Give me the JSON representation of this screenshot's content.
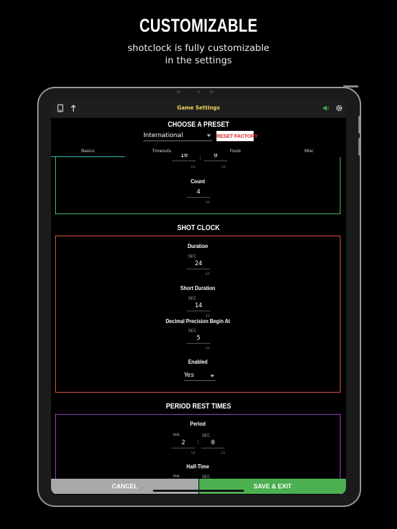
{
  "promo": {
    "headline": "CUSTOMIZABLE",
    "tagline_line1": "shotclock is fully customizable",
    "tagline_line2": "in the settings"
  },
  "app": {
    "title": "Game Settings",
    "preset_heading": "CHOOSE A PRESET",
    "preset_value": "International",
    "reset_label": "RESET FACTORY",
    "tabs": [
      "Basics",
      "Timeouts",
      "Fouls",
      "Misc"
    ],
    "active_tab": "Basics"
  },
  "partial_panel": {
    "min_value": "10",
    "sec_value": "0",
    "min_count": "2/3",
    "sec_count": "1/2",
    "count_label": "Count",
    "count_value": "4",
    "count_counter": "1/2"
  },
  "shot_clock": {
    "heading": "SHOT CLOCK",
    "duration_label": "Duration",
    "duration_unit": "SEC",
    "duration_value": "24",
    "duration_counter": "2/2",
    "short_label": "Short Duration",
    "short_unit": "SEC",
    "short_value": "14",
    "short_counter": "2/2",
    "decimal_label": "Decimal Precision Begin At",
    "decimal_unit": "SEC",
    "decimal_value": "5",
    "decimal_counter": "1/2",
    "enabled_label": "Enabled",
    "enabled_value": "Yes"
  },
  "period_rest": {
    "heading": "PERIOD REST TIMES",
    "period_label": "Period",
    "min_unit": "MIN",
    "sec_unit": "SEC",
    "period_min": "2",
    "period_sec": "0",
    "period_min_counter": "1/3",
    "period_sec_counter": "1/2",
    "halftime_label": "Half-Time",
    "half_min_unit": "MIN",
    "half_sec_unit": "SEC"
  },
  "footer": {
    "cancel_label": "CANCEL",
    "save_label": "SAVE & EXIT"
  },
  "colors": {
    "title_accent": "#f2d35a",
    "tab_accent": "#2ec4b6",
    "panel_green": "#3fbf5a",
    "panel_red": "#e2553f",
    "panel_purple": "#9b3fc8",
    "save_green": "#4caf50",
    "cancel_gray": "#a8a8a8",
    "reset_red": "#e02c2c"
  },
  "icons": {
    "left1": "tablet-icon",
    "left2": "arrow-up-icon",
    "right1": "speaker-icon",
    "right2": "gear-icon"
  }
}
